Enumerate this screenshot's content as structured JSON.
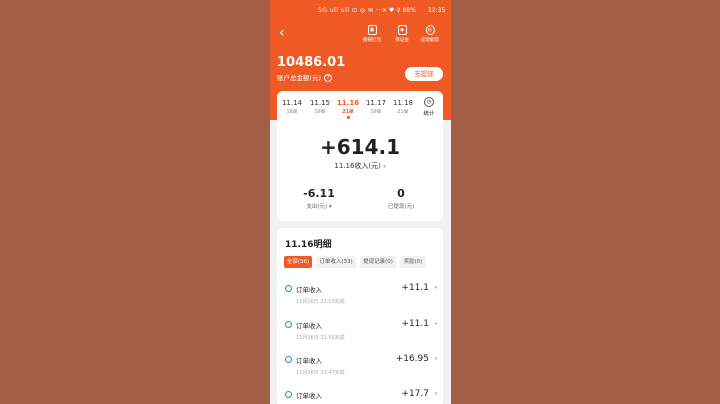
{
  "status_bar": {
    "left": "5G ull ull ⊡ ◎ ✉ ···",
    "right": "✕ ♥ ⚲ 88%",
    "time": "12:35"
  },
  "header": {
    "back_icon": "chevron-left-icon",
    "actions": [
      {
        "label": "播报红包",
        "icon": "gift-icon"
      },
      {
        "label": "保证金",
        "icon": "shield-icon"
      },
      {
        "label": "提现额度",
        "icon": "settings-icon"
      }
    ],
    "balance": "10486.01",
    "balance_label": "账户总金额(元)",
    "withdraw_button": "去提现",
    "accent": "#ef5a24"
  },
  "dates": [
    {
      "date": "11.14",
      "count": "16单"
    },
    {
      "date": "11.15",
      "count": "19单"
    },
    {
      "date": "11.16",
      "count": "21单",
      "active": true
    },
    {
      "date": "11.17",
      "count": "19单"
    },
    {
      "date": "11.18",
      "count": "21单"
    }
  ],
  "stats_label": "统计",
  "summary": {
    "income": "+614.1",
    "income_label": "11.16收入(元)",
    "expense_value": "-6.11",
    "expense_label": "支出(元)",
    "withdrawn_value": "0",
    "withdrawn_label": "已提现(元)"
  },
  "detail": {
    "title": "11.16明细",
    "filters": [
      "全部(36)",
      "订单收入(33)",
      "提现记录(0)",
      "奖励(0)"
    ],
    "rows": [
      {
        "title": "订单收入",
        "time": "11月16日 22:13完成",
        "amount": "+11.1"
      },
      {
        "title": "订单收入",
        "time": "11月16日 21:56完成",
        "amount": "+11.1"
      },
      {
        "title": "订单收入",
        "time": "11月16日 21:47完成",
        "amount": "+16.95"
      },
      {
        "title": "订单收入",
        "time": "",
        "amount": "+17.7"
      }
    ]
  }
}
